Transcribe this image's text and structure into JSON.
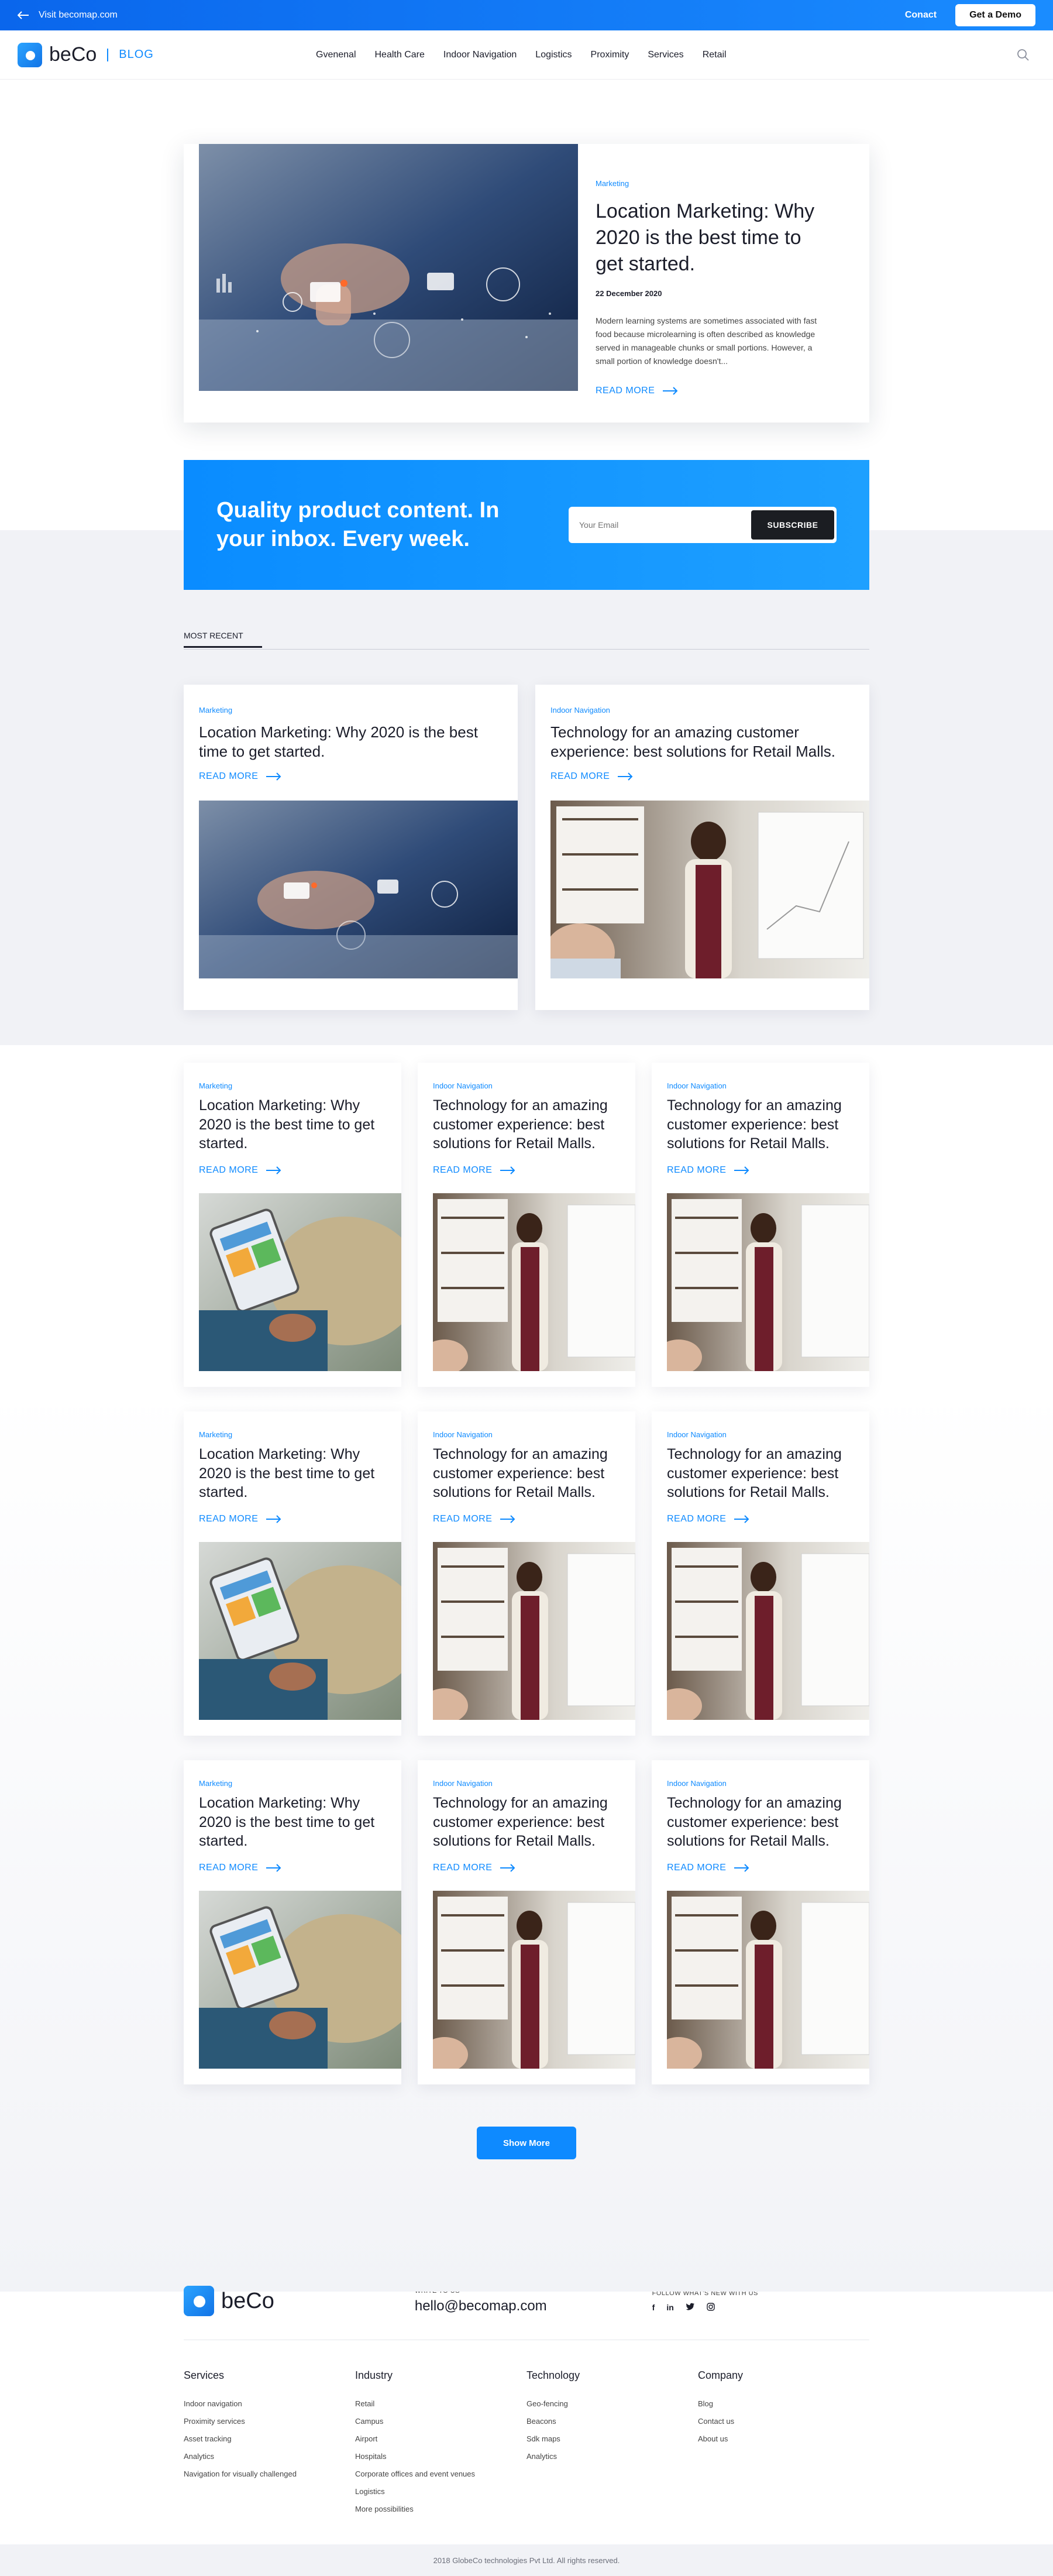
{
  "topbar": {
    "visit_label": "Visit becomap.com",
    "contact_label": "Conact",
    "demo_label": "Get a Demo"
  },
  "nav": {
    "brand": "beCo",
    "section": "BLOG",
    "links": [
      "Gvenenal",
      "Health Care",
      "Indoor Navigation",
      "Logistics",
      "Proximity",
      "Services",
      "Retail"
    ]
  },
  "hero": {
    "tag": "Marketing",
    "title": "Location Marketing: Why 2020 is the best time to get started.",
    "date": "22 December 2020",
    "excerpt": "Modern learning systems are sometimes associated with fast food because microlearning is often described as knowledge served in manageable chunks or small portions. However, a small portion of knowledge doesn't...",
    "read_more": "READ MORE"
  },
  "subscribe": {
    "headline": "Quality product content. In your inbox. Every week.",
    "placeholder": "Your Email",
    "button": "SUBSCRIBE"
  },
  "recent": {
    "tab": "MOST RECENT",
    "cards": [
      {
        "tag": "Marketing",
        "title": "Location Marketing: Why 2020 is the best time to get started.",
        "read_more": "READ MORE"
      },
      {
        "tag": "Indoor Navigation",
        "title": "Technology for an amazing customer experience: best solutions for Retail Malls.",
        "read_more": "READ MORE"
      }
    ]
  },
  "grid": [
    {
      "tag": "Marketing",
      "title": "Location Marketing: Why 2020 is the best time to get started.",
      "read_more": "READ MORE"
    },
    {
      "tag": "Indoor Navigation",
      "title": "Technology for an amazing customer experience: best solutions for Retail Malls.",
      "read_more": "READ MORE"
    },
    {
      "tag": "Indoor Navigation",
      "title": "Technology for an amazing customer experience: best solutions for Retail Malls.",
      "read_more": "READ MORE"
    },
    {
      "tag": "Marketing",
      "title": "Location Marketing: Why 2020 is the best time to get started.",
      "read_more": "READ MORE"
    },
    {
      "tag": "Indoor Navigation",
      "title": "Technology for an amazing customer experience: best solutions for Retail Malls.",
      "read_more": "READ MORE"
    },
    {
      "tag": "Indoor Navigation",
      "title": "Technology for an amazing customer experience: best solutions for Retail Malls.",
      "read_more": "READ MORE"
    },
    {
      "tag": "Marketing",
      "title": "Location Marketing: Why 2020 is the best time to get started.",
      "read_more": "READ MORE"
    },
    {
      "tag": "Indoor Navigation",
      "title": "Technology for an amazing customer experience: best solutions for Retail Malls.",
      "read_more": "READ MORE"
    },
    {
      "tag": "Indoor Navigation",
      "title": "Technology for an amazing customer experience: best solutions for Retail Malls.",
      "read_more": "READ MORE"
    }
  ],
  "show_more": "Show More",
  "footer": {
    "brand": "beCo",
    "write_label": "WRITE TO US",
    "email": "hello@becomap.com",
    "follow_label": "FOLLOW WHAT'S NEW WITH US",
    "socials": [
      "facebook-icon",
      "linkedin-icon",
      "twitter-icon",
      "instagram-icon"
    ],
    "columns": [
      {
        "title": "Services",
        "items": [
          "Indoor navigation",
          "Proximity services",
          "Asset tracking",
          "Analytics",
          "Navigation for visually challenged"
        ]
      },
      {
        "title": "Industry",
        "items": [
          "Retail",
          "Campus",
          "Airport",
          "Hospitals",
          "Corporate offices and event venues",
          "Logistics",
          "More possibilities"
        ]
      },
      {
        "title": "Technology",
        "items": [
          "Geo-fencing",
          "Beacons",
          "Sdk maps",
          "Analytics"
        ]
      },
      {
        "title": "Company",
        "items": [
          "Blog",
          "Contact us",
          "About us"
        ]
      }
    ],
    "copyright": "2018 GlobeCo technologies Pvt Ltd. All rights reserved."
  },
  "colors": {
    "accent": "#0e8aff",
    "topbar": "#0a66ec",
    "dark_button": "#1b1d22",
    "grey_bg": "#f1f2f6"
  }
}
